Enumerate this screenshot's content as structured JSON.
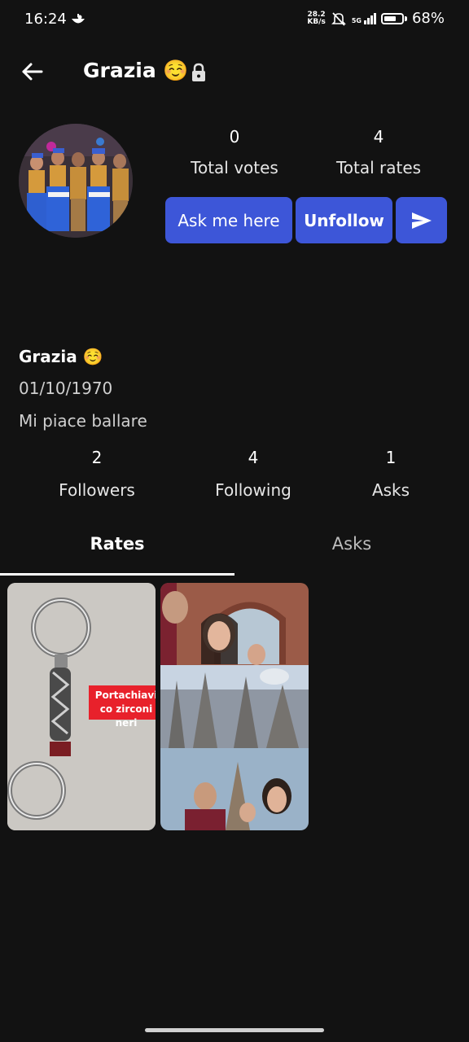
{
  "status_bar": {
    "time": "16:24",
    "net_speed_top": "28.2",
    "net_speed_bottom": "KB/s",
    "network": "5G",
    "battery": "68%",
    "battery_level": 0.68
  },
  "header": {
    "title": "Grazia ☺️"
  },
  "stats": {
    "votes_value": "0",
    "votes_label": "Total votes",
    "rates_value": "4",
    "rates_label": "Total rates"
  },
  "actions": {
    "ask_label": "Ask me here",
    "unfollow_label": "Unfollow"
  },
  "profile": {
    "name": "Grazia ☺️",
    "birthdate": "01/10/1970",
    "bio": "Mi piace ballare"
  },
  "counts": {
    "followers_value": "2",
    "followers_label": "Followers",
    "following_value": "4",
    "following_label": "Following",
    "asks_value": "1",
    "asks_label": "Asks"
  },
  "tabs": {
    "rates": "Rates",
    "asks": "Asks"
  },
  "posts": {
    "first_overlay": "Portachiavi co zirconi neri"
  },
  "colors": {
    "background": "#121212",
    "accent": "#3d56d8",
    "overlay_red": "#e8212b"
  }
}
